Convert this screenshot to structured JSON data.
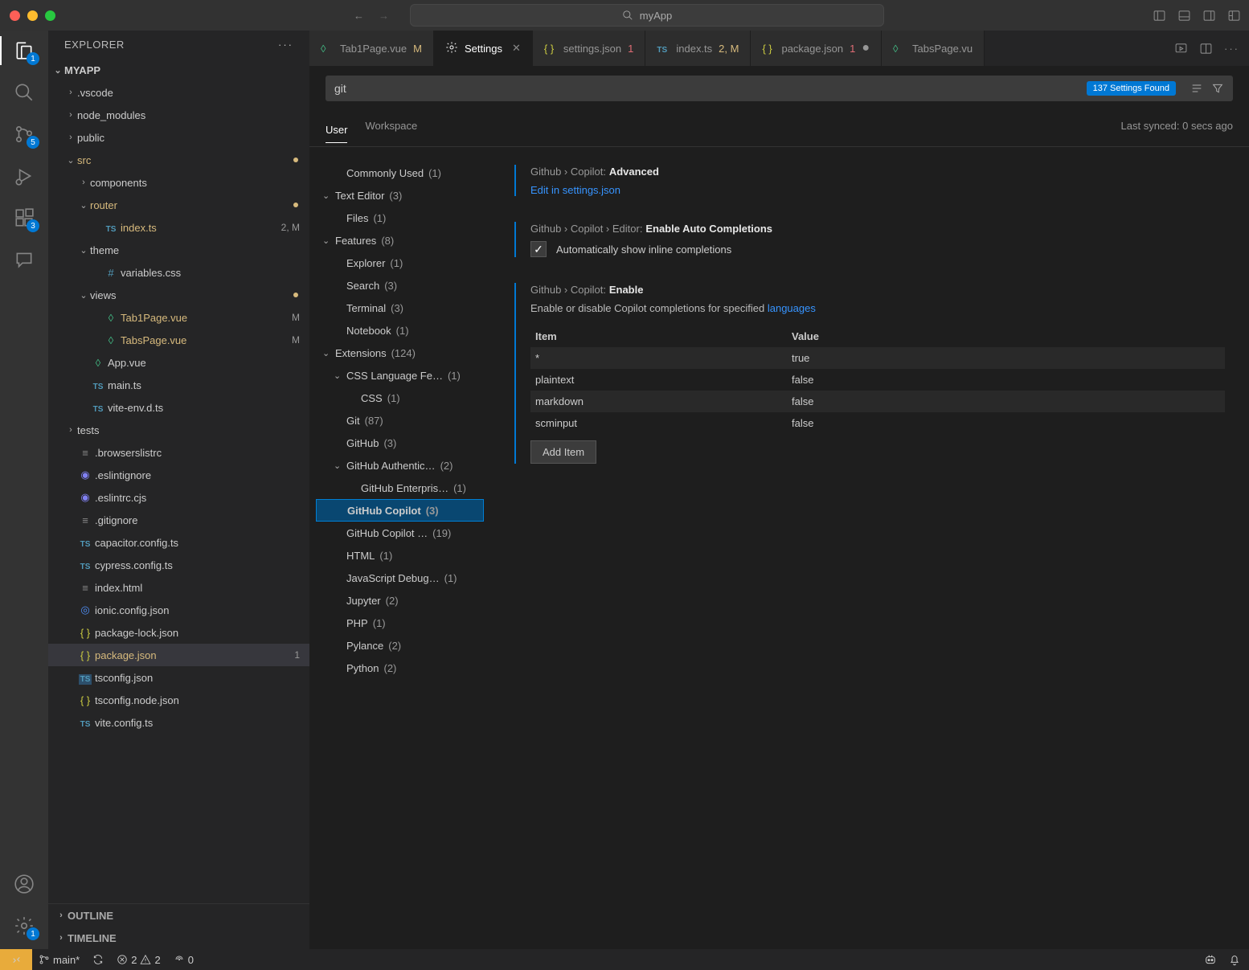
{
  "title": "myApp",
  "activity": {
    "badges": {
      "files": "1",
      "scm": "5",
      "ext": "3",
      "gear": "1"
    }
  },
  "explorer": {
    "title": "EXPLORER",
    "root": "MYAPP",
    "outline": "OUTLINE",
    "timeline": "TIMELINE",
    "tree": [
      {
        "d": 1,
        "t": "folder",
        "name": ".vscode"
      },
      {
        "d": 1,
        "t": "folder",
        "name": "node_modules"
      },
      {
        "d": 1,
        "t": "folder",
        "name": "public"
      },
      {
        "d": 1,
        "t": "folder-open",
        "name": "src",
        "cls": "yel",
        "dot": true
      },
      {
        "d": 2,
        "t": "folder",
        "name": "components"
      },
      {
        "d": 2,
        "t": "folder-open",
        "name": "router",
        "cls": "yel",
        "dot": true
      },
      {
        "d": 3,
        "t": "ts",
        "name": "index.ts",
        "cls": "yel",
        "tag": "2, M"
      },
      {
        "d": 2,
        "t": "folder-open",
        "name": "theme"
      },
      {
        "d": 3,
        "t": "css",
        "name": "variables.css"
      },
      {
        "d": 2,
        "t": "folder-open",
        "name": "views",
        "dot": true
      },
      {
        "d": 3,
        "t": "vue",
        "name": "Tab1Page.vue",
        "cls": "mod",
        "tag": "M"
      },
      {
        "d": 3,
        "t": "vue",
        "name": "TabsPage.vue",
        "cls": "mod",
        "tag": "M"
      },
      {
        "d": 2,
        "t": "vue",
        "name": "App.vue"
      },
      {
        "d": 2,
        "t": "ts",
        "name": "main.ts"
      },
      {
        "d": 2,
        "t": "ts",
        "name": "vite-env.d.ts"
      },
      {
        "d": 1,
        "t": "folder",
        "name": "tests"
      },
      {
        "d": 1,
        "t": "file",
        "name": ".browserslistrc"
      },
      {
        "d": 1,
        "t": "eslint",
        "name": ".eslintignore"
      },
      {
        "d": 1,
        "t": "eslint",
        "name": ".eslintrc.cjs"
      },
      {
        "d": 1,
        "t": "file",
        "name": ".gitignore"
      },
      {
        "d": 1,
        "t": "ts",
        "name": "capacitor.config.ts"
      },
      {
        "d": 1,
        "t": "ts",
        "name": "cypress.config.ts"
      },
      {
        "d": 1,
        "t": "file",
        "name": "index.html"
      },
      {
        "d": 1,
        "t": "ionic",
        "name": "ionic.config.json"
      },
      {
        "d": 1,
        "t": "json",
        "name": "package-lock.json"
      },
      {
        "d": 1,
        "t": "json",
        "name": "package.json",
        "cls": "yel",
        "tag": "1",
        "sel": true
      },
      {
        "d": 1,
        "t": "tsc",
        "name": "tsconfig.json"
      },
      {
        "d": 1,
        "t": "json",
        "name": "tsconfig.node.json"
      },
      {
        "d": 1,
        "t": "ts",
        "name": "vite.config.ts"
      }
    ]
  },
  "tabs": [
    {
      "icon": "vue",
      "label": "Tab1Page.vue",
      "suffix": "M",
      "scls": "m"
    },
    {
      "icon": "gear",
      "label": "Settings",
      "active": true,
      "close": true
    },
    {
      "icon": "json",
      "label": "settings.json",
      "suffix": "1",
      "scls": "err"
    },
    {
      "icon": "ts",
      "label": "index.ts",
      "suffix": "2, M",
      "scls": "m"
    },
    {
      "icon": "json",
      "label": "package.json",
      "suffix": "1",
      "scls": "err",
      "dirty": true
    },
    {
      "icon": "vue",
      "label": "TabsPage.vu"
    }
  ],
  "search": {
    "value": "git",
    "found": "137 Settings Found"
  },
  "scope": {
    "user": "User",
    "workspace": "Workspace",
    "sync": "Last synced: 0 secs ago"
  },
  "toc": [
    {
      "d": 1,
      "name": "Commonly Used",
      "cnt": "(1)"
    },
    {
      "d": 0,
      "name": "Text Editor",
      "cnt": "(3)",
      "open": true
    },
    {
      "d": 1,
      "name": "Files",
      "cnt": "(1)"
    },
    {
      "d": 0,
      "name": "Features",
      "cnt": "(8)",
      "open": true
    },
    {
      "d": 1,
      "name": "Explorer",
      "cnt": "(1)"
    },
    {
      "d": 1,
      "name": "Search",
      "cnt": "(3)"
    },
    {
      "d": 1,
      "name": "Terminal",
      "cnt": "(3)"
    },
    {
      "d": 1,
      "name": "Notebook",
      "cnt": "(1)"
    },
    {
      "d": 0,
      "name": "Extensions",
      "cnt": "(124)",
      "open": true
    },
    {
      "d": 1,
      "name": "CSS Language Fe…",
      "cnt": "(1)",
      "open": true
    },
    {
      "d": 2,
      "name": "CSS",
      "cnt": "(1)"
    },
    {
      "d": 1,
      "name": "Git",
      "cnt": "(87)"
    },
    {
      "d": 1,
      "name": "GitHub",
      "cnt": "(3)"
    },
    {
      "d": 1,
      "name": "GitHub Authentic…",
      "cnt": "(2)",
      "open": true
    },
    {
      "d": 2,
      "name": "GitHub Enterpris…",
      "cnt": "(1)"
    },
    {
      "d": 1,
      "name": "GitHub Copilot",
      "cnt": "(3)",
      "selected": true
    },
    {
      "d": 1,
      "name": "GitHub Copilot …",
      "cnt": "(19)"
    },
    {
      "d": 1,
      "name": "HTML",
      "cnt": "(1)"
    },
    {
      "d": 1,
      "name": "JavaScript Debug…",
      "cnt": "(1)"
    },
    {
      "d": 1,
      "name": "Jupyter",
      "cnt": "(2)"
    },
    {
      "d": 1,
      "name": "PHP",
      "cnt": "(1)"
    },
    {
      "d": 1,
      "name": "Pylance",
      "cnt": "(2)"
    },
    {
      "d": 1,
      "name": "Python",
      "cnt": "(2)"
    }
  ],
  "settings": {
    "s1": {
      "path": "Github › Copilot:",
      "title": "Advanced",
      "link": "Edit in settings.json"
    },
    "s2": {
      "path": "Github › Copilot › Editor:",
      "title": "Enable Auto Completions",
      "chk": "Automatically show inline completions"
    },
    "s3": {
      "path": "Github › Copilot:",
      "title": "Enable",
      "desc1": "Enable or disable Copilot completions for specified ",
      "desc2": "languages",
      "th1": "Item",
      "th2": "Value",
      "rows": [
        [
          "*",
          "true"
        ],
        [
          "plaintext",
          "false"
        ],
        [
          "markdown",
          "false"
        ],
        [
          "scminput",
          "false"
        ]
      ],
      "add": "Add Item"
    }
  },
  "status": {
    "branch": "main*",
    "err": "2",
    "warn": "2",
    "port": "0"
  }
}
